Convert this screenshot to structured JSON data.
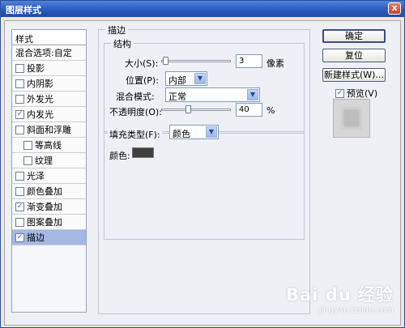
{
  "window": {
    "title": "图层样式",
    "close_glyph": "x"
  },
  "left_list": {
    "header": "样式",
    "items": [
      {
        "label": "混合选项:自定",
        "checkbox": false,
        "checked": false,
        "indent": false,
        "selected": false
      },
      {
        "label": "投影",
        "checkbox": true,
        "checked": false,
        "indent": false,
        "selected": false
      },
      {
        "label": "内阴影",
        "checkbox": true,
        "checked": false,
        "indent": false,
        "selected": false
      },
      {
        "label": "外发光",
        "checkbox": true,
        "checked": false,
        "indent": false,
        "selected": false
      },
      {
        "label": "内发光",
        "checkbox": true,
        "checked": true,
        "indent": false,
        "selected": false
      },
      {
        "label": "斜面和浮雕",
        "checkbox": true,
        "checked": false,
        "indent": false,
        "selected": false
      },
      {
        "label": "等高线",
        "checkbox": true,
        "checked": false,
        "indent": true,
        "selected": false
      },
      {
        "label": "纹理",
        "checkbox": true,
        "checked": false,
        "indent": true,
        "selected": false
      },
      {
        "label": "光泽",
        "checkbox": true,
        "checked": false,
        "indent": false,
        "selected": false
      },
      {
        "label": "颜色叠加",
        "checkbox": true,
        "checked": false,
        "indent": false,
        "selected": false
      },
      {
        "label": "渐变叠加",
        "checkbox": true,
        "checked": true,
        "indent": false,
        "selected": false
      },
      {
        "label": "图案叠加",
        "checkbox": true,
        "checked": false,
        "indent": false,
        "selected": false
      },
      {
        "label": "描边",
        "checkbox": true,
        "checked": true,
        "indent": false,
        "selected": true
      }
    ]
  },
  "stroke_panel": {
    "title": "描边",
    "structure": {
      "title": "结构",
      "size_label": "大小(S):",
      "size_value": "3",
      "size_unit": "像素",
      "size_fraction": 0.03,
      "position_label": "位置(P):",
      "position_value": "内部",
      "blend_label": "混合模式:",
      "blend_value": "正常",
      "opacity_label": "不透明度(O):",
      "opacity_value": "40",
      "opacity_unit": "%",
      "opacity_fraction": 0.4
    },
    "fill": {
      "type_label": "填充类型(F):",
      "type_value": "颜色",
      "color_label": "颜色:",
      "color_value": "#3f3f3f"
    }
  },
  "buttons": {
    "ok": "确定",
    "reset": "复位",
    "new_style": "新建样式(W)...",
    "preview_label": "预览(V)",
    "preview_checked": true
  },
  "watermark": {
    "line1": "Bai du 经验",
    "line2": "jingyan.baidu.com"
  },
  "colors": {
    "titlebar": "#2a5bbf",
    "selected": "#a4b8e4",
    "dialog": "#eef0f6"
  },
  "icons": {
    "checkbox": "check-mark",
    "dropdown": "chevron-down-icon"
  }
}
